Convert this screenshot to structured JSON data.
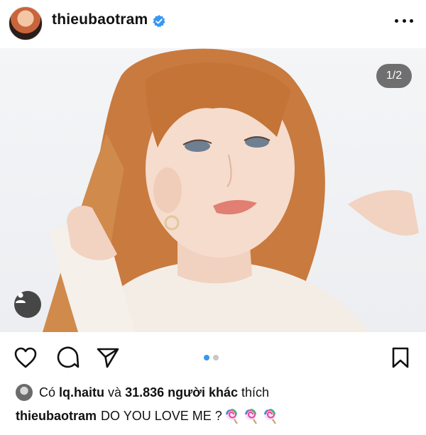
{
  "post": {
    "username": "thieubaotram",
    "photo_counter": "1/2"
  },
  "likes": {
    "prefix": "Có",
    "liker": "lq.haitu",
    "connector": "và",
    "count": "31.836 người khác",
    "suffix": "thích"
  },
  "caption": {
    "username": "thieubaotram",
    "text": "DO YOU LOVE ME ?",
    "emoji": [
      "lollipop",
      "lollipop",
      "lollipop"
    ]
  },
  "carousel": {
    "current": 1,
    "total": 2,
    "active_color": "#3897f0",
    "inactive_color": "#c7c7c7"
  },
  "colors": {
    "verified": "#3897f0",
    "hair": "#c97a3f"
  },
  "icons": [
    "verified-badge-icon",
    "more-options-icon",
    "photo-tag-icon",
    "heart-icon",
    "comment-icon",
    "share-icon",
    "bookmark-icon",
    "lollipop-icon"
  ]
}
